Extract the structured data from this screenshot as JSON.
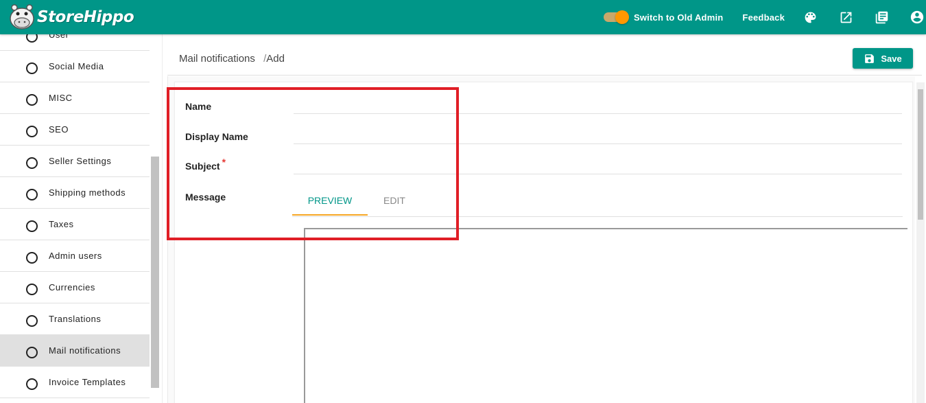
{
  "topbar": {
    "brand": "StoreHippo",
    "switch_label": "Switch to Old Admin",
    "switch_on": true,
    "feedback_label": "Feedback",
    "icons": [
      "palette-icon",
      "open-external-icon",
      "library-icon",
      "account-icon"
    ],
    "color": "#009688"
  },
  "sidebar": {
    "items": [
      {
        "label": "User",
        "active": false
      },
      {
        "label": "Social Media",
        "active": false
      },
      {
        "label": "MISC",
        "active": false
      },
      {
        "label": "SEO",
        "active": false
      },
      {
        "label": "Seller Settings",
        "active": false
      },
      {
        "label": "Shipping methods",
        "active": false
      },
      {
        "label": "Taxes",
        "active": false
      },
      {
        "label": "Admin users",
        "active": false
      },
      {
        "label": "Currencies",
        "active": false
      },
      {
        "label": "Translations",
        "active": false
      },
      {
        "label": "Mail notifications",
        "active": true
      },
      {
        "label": "Invoice Templates",
        "active": false
      }
    ]
  },
  "breadcrumb": {
    "section": "Mail notifications",
    "separator": "/",
    "current": "Add"
  },
  "toolbar": {
    "save_label": "Save"
  },
  "form": {
    "name_label": "Name",
    "name_value": "",
    "display_name_label": "Display Name",
    "display_name_value": "",
    "subject_label": "Subject",
    "subject_required": "*",
    "subject_value": "",
    "message_label": "Message",
    "tabs": [
      {
        "label": "PREVIEW",
        "active": true
      },
      {
        "label": "EDIT",
        "active": false
      }
    ]
  },
  "colors": {
    "accent": "#009688",
    "tab_indicator": "#f5a623",
    "highlight": "#e01e26",
    "required": "#e53935"
  }
}
